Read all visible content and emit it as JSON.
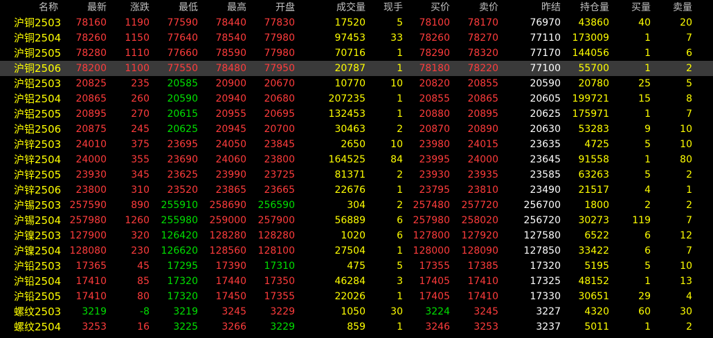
{
  "columns": [
    "名称",
    "最新",
    "涨跌",
    "最低",
    "最高",
    "开盘",
    "成交量",
    "现手",
    "买价",
    "卖价",
    "昨结",
    "持仓量",
    "买量",
    "卖量"
  ],
  "colors": {
    "up": "#ff3c3c",
    "down": "#00e000",
    "neutral": "#ffffff",
    "volume": "#ffff00",
    "selected_row_bg": "#3a3a3a"
  },
  "selected_index": 3,
  "rows": [
    {
      "name": "沪铜2503",
      "last": "78160",
      "change": "1190",
      "low": "77590",
      "high": "78440",
      "open": "77830",
      "volume": "17520",
      "tick": "5",
      "bid": "78100",
      "ask": "78170",
      "prev": "76970",
      "oi": "43860",
      "bidvol": "40",
      "askvol": "20",
      "dir": {
        "last": "up",
        "change": "up",
        "low": "up",
        "high": "up",
        "open": "up",
        "bid": "up",
        "ask": "up"
      }
    },
    {
      "name": "沪铜2504",
      "last": "78260",
      "change": "1150",
      "low": "77640",
      "high": "78540",
      "open": "77980",
      "volume": "97453",
      "tick": "33",
      "bid": "78260",
      "ask": "78270",
      "prev": "77110",
      "oi": "173009",
      "bidvol": "1",
      "askvol": "7",
      "dir": {
        "last": "up",
        "change": "up",
        "low": "up",
        "high": "up",
        "open": "up",
        "bid": "up",
        "ask": "up"
      }
    },
    {
      "name": "沪铜2505",
      "last": "78280",
      "change": "1110",
      "low": "77660",
      "high": "78590",
      "open": "77980",
      "volume": "70716",
      "tick": "1",
      "bid": "78290",
      "ask": "78320",
      "prev": "77170",
      "oi": "144056",
      "bidvol": "1",
      "askvol": "6",
      "dir": {
        "last": "up",
        "change": "up",
        "low": "up",
        "high": "up",
        "open": "up",
        "bid": "up",
        "ask": "up"
      }
    },
    {
      "name": "沪铜2506",
      "last": "78200",
      "change": "1100",
      "low": "77550",
      "high": "78480",
      "open": "77950",
      "volume": "20787",
      "tick": "1",
      "bid": "78180",
      "ask": "78220",
      "prev": "77100",
      "oi": "55700",
      "bidvol": "1",
      "askvol": "2",
      "dir": {
        "last": "up",
        "change": "up",
        "low": "up",
        "high": "up",
        "open": "up",
        "bid": "up",
        "ask": "up"
      }
    },
    {
      "name": "沪铝2503",
      "last": "20825",
      "change": "235",
      "low": "20585",
      "high": "20900",
      "open": "20670",
      "volume": "10770",
      "tick": "10",
      "bid": "20820",
      "ask": "20855",
      "prev": "20590",
      "oi": "20780",
      "bidvol": "25",
      "askvol": "5",
      "dir": {
        "last": "up",
        "change": "up",
        "low": "down",
        "high": "up",
        "open": "up",
        "bid": "up",
        "ask": "up"
      }
    },
    {
      "name": "沪铝2504",
      "last": "20865",
      "change": "260",
      "low": "20590",
      "high": "20940",
      "open": "20680",
      "volume": "207235",
      "tick": "1",
      "bid": "20855",
      "ask": "20865",
      "prev": "20605",
      "oi": "199721",
      "bidvol": "15",
      "askvol": "8",
      "dir": {
        "last": "up",
        "change": "up",
        "low": "down",
        "high": "up",
        "open": "up",
        "bid": "up",
        "ask": "up"
      }
    },
    {
      "name": "沪铝2505",
      "last": "20895",
      "change": "270",
      "low": "20615",
      "high": "20955",
      "open": "20695",
      "volume": "132453",
      "tick": "1",
      "bid": "20880",
      "ask": "20895",
      "prev": "20625",
      "oi": "175971",
      "bidvol": "1",
      "askvol": "7",
      "dir": {
        "last": "up",
        "change": "up",
        "low": "down",
        "high": "up",
        "open": "up",
        "bid": "up",
        "ask": "up"
      }
    },
    {
      "name": "沪铝2506",
      "last": "20875",
      "change": "245",
      "low": "20625",
      "high": "20945",
      "open": "20700",
      "volume": "30463",
      "tick": "2",
      "bid": "20870",
      "ask": "20890",
      "prev": "20630",
      "oi": "53283",
      "bidvol": "9",
      "askvol": "10",
      "dir": {
        "last": "up",
        "change": "up",
        "low": "down",
        "high": "up",
        "open": "up",
        "bid": "up",
        "ask": "up"
      }
    },
    {
      "name": "沪锌2503",
      "last": "24010",
      "change": "375",
      "low": "23695",
      "high": "24050",
      "open": "23845",
      "volume": "2650",
      "tick": "10",
      "bid": "23980",
      "ask": "24015",
      "prev": "23635",
      "oi": "4725",
      "bidvol": "5",
      "askvol": "10",
      "dir": {
        "last": "up",
        "change": "up",
        "low": "up",
        "high": "up",
        "open": "up",
        "bid": "up",
        "ask": "up"
      }
    },
    {
      "name": "沪锌2504",
      "last": "24000",
      "change": "355",
      "low": "23690",
      "high": "24060",
      "open": "23800",
      "volume": "164525",
      "tick": "84",
      "bid": "23995",
      "ask": "24000",
      "prev": "23645",
      "oi": "91558",
      "bidvol": "1",
      "askvol": "80",
      "dir": {
        "last": "up",
        "change": "up",
        "low": "up",
        "high": "up",
        "open": "up",
        "bid": "up",
        "ask": "up"
      }
    },
    {
      "name": "沪锌2505",
      "last": "23930",
      "change": "345",
      "low": "23625",
      "high": "23990",
      "open": "23725",
      "volume": "81371",
      "tick": "2",
      "bid": "23930",
      "ask": "23935",
      "prev": "23585",
      "oi": "63263",
      "bidvol": "5",
      "askvol": "2",
      "dir": {
        "last": "up",
        "change": "up",
        "low": "up",
        "high": "up",
        "open": "up",
        "bid": "up",
        "ask": "up"
      }
    },
    {
      "name": "沪锌2506",
      "last": "23800",
      "change": "310",
      "low": "23520",
      "high": "23865",
      "open": "23665",
      "volume": "22676",
      "tick": "1",
      "bid": "23795",
      "ask": "23810",
      "prev": "23490",
      "oi": "21517",
      "bidvol": "4",
      "askvol": "1",
      "dir": {
        "last": "up",
        "change": "up",
        "low": "up",
        "high": "up",
        "open": "up",
        "bid": "up",
        "ask": "up"
      }
    },
    {
      "name": "沪锡2503",
      "last": "257590",
      "change": "890",
      "low": "255910",
      "high": "258690",
      "open": "256590",
      "volume": "304",
      "tick": "2",
      "bid": "257480",
      "ask": "257720",
      "prev": "256700",
      "oi": "1800",
      "bidvol": "2",
      "askvol": "2",
      "dir": {
        "last": "up",
        "change": "up",
        "low": "down",
        "high": "up",
        "open": "down",
        "bid": "up",
        "ask": "up"
      }
    },
    {
      "name": "沪锡2504",
      "last": "257980",
      "change": "1260",
      "low": "255980",
      "high": "259000",
      "open": "257900",
      "volume": "56889",
      "tick": "6",
      "bid": "257980",
      "ask": "258020",
      "prev": "256720",
      "oi": "30273",
      "bidvol": "119",
      "askvol": "7",
      "dir": {
        "last": "up",
        "change": "up",
        "low": "down",
        "high": "up",
        "open": "up",
        "bid": "up",
        "ask": "up"
      }
    },
    {
      "name": "沪镍2503",
      "last": "127900",
      "change": "320",
      "low": "126420",
      "high": "128280",
      "open": "128280",
      "volume": "1020",
      "tick": "6",
      "bid": "127800",
      "ask": "127920",
      "prev": "127580",
      "oi": "6522",
      "bidvol": "6",
      "askvol": "12",
      "dir": {
        "last": "up",
        "change": "up",
        "low": "down",
        "high": "up",
        "open": "up",
        "bid": "up",
        "ask": "up"
      }
    },
    {
      "name": "沪镍2504",
      "last": "128080",
      "change": "230",
      "low": "126620",
      "high": "128560",
      "open": "128100",
      "volume": "27504",
      "tick": "1",
      "bid": "128000",
      "ask": "128090",
      "prev": "127850",
      "oi": "33422",
      "bidvol": "6",
      "askvol": "7",
      "dir": {
        "last": "up",
        "change": "up",
        "low": "down",
        "high": "up",
        "open": "up",
        "bid": "up",
        "ask": "up"
      }
    },
    {
      "name": "沪铅2503",
      "last": "17365",
      "change": "45",
      "low": "17295",
      "high": "17390",
      "open": "17310",
      "volume": "475",
      "tick": "5",
      "bid": "17355",
      "ask": "17385",
      "prev": "17320",
      "oi": "5195",
      "bidvol": "5",
      "askvol": "10",
      "dir": {
        "last": "up",
        "change": "up",
        "low": "down",
        "high": "up",
        "open": "down",
        "bid": "up",
        "ask": "up"
      }
    },
    {
      "name": "沪铅2504",
      "last": "17410",
      "change": "85",
      "low": "17320",
      "high": "17440",
      "open": "17350",
      "volume": "46284",
      "tick": "3",
      "bid": "17405",
      "ask": "17410",
      "prev": "17325",
      "oi": "48152",
      "bidvol": "1",
      "askvol": "13",
      "dir": {
        "last": "up",
        "change": "up",
        "low": "down",
        "high": "up",
        "open": "up",
        "bid": "up",
        "ask": "up"
      }
    },
    {
      "name": "沪铅2505",
      "last": "17410",
      "change": "80",
      "low": "17320",
      "high": "17450",
      "open": "17355",
      "volume": "22026",
      "tick": "1",
      "bid": "17405",
      "ask": "17410",
      "prev": "17330",
      "oi": "30651",
      "bidvol": "29",
      "askvol": "4",
      "dir": {
        "last": "up",
        "change": "up",
        "low": "down",
        "high": "up",
        "open": "up",
        "bid": "up",
        "ask": "up"
      }
    },
    {
      "name": "螺纹2503",
      "last": "3219",
      "change": "-8",
      "low": "3219",
      "high": "3245",
      "open": "3229",
      "volume": "1050",
      "tick": "30",
      "bid": "3224",
      "ask": "3245",
      "prev": "3227",
      "oi": "4320",
      "bidvol": "60",
      "askvol": "30",
      "dir": {
        "last": "down",
        "change": "down",
        "low": "down",
        "high": "up",
        "open": "up",
        "bid": "down",
        "ask": "up"
      }
    },
    {
      "name": "螺纹2504",
      "last": "3253",
      "change": "16",
      "low": "3225",
      "high": "3266",
      "open": "3229",
      "volume": "859",
      "tick": "1",
      "bid": "3246",
      "ask": "3253",
      "prev": "3237",
      "oi": "5011",
      "bidvol": "1",
      "askvol": "2",
      "dir": {
        "last": "up",
        "change": "up",
        "low": "down",
        "high": "up",
        "open": "down",
        "bid": "up",
        "ask": "up"
      }
    }
  ]
}
